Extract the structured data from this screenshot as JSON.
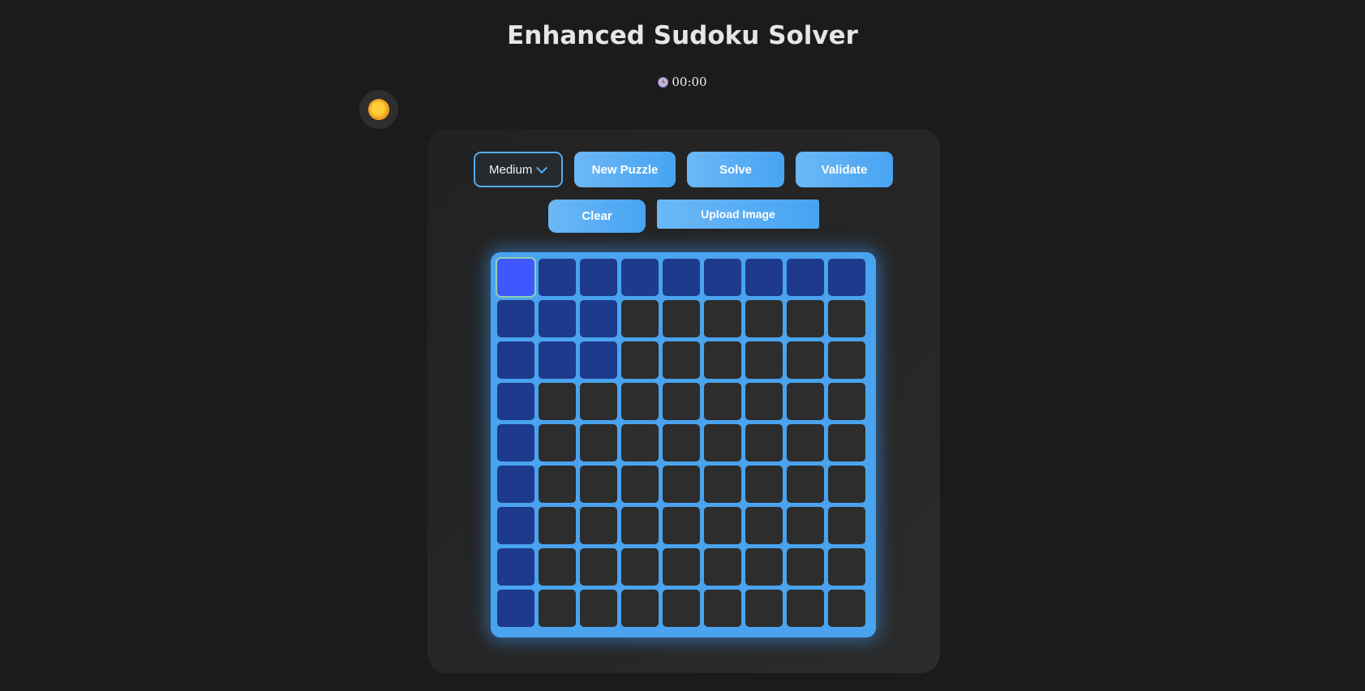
{
  "header": {
    "title": "Enhanced Sudoku Solver",
    "timer": "00:00",
    "timer_icon": "alarm-clock-icon"
  },
  "theme_toggle": {
    "icon": "sun-icon"
  },
  "controls": {
    "difficulty": {
      "selected": "Medium",
      "icon": "chevron-down-icon"
    },
    "new_puzzle_label": "New Puzzle",
    "solve_label": "Solve",
    "validate_label": "Validate",
    "clear_label": "Clear",
    "upload_label": "Upload Image"
  },
  "board": {
    "size": 9,
    "selected": [
      0,
      0
    ],
    "colors": {
      "border": "#4aa3ee",
      "empty": "#2d2d2d",
      "related": "#1d3a8c",
      "selected": "#3f57ff"
    },
    "cells": [
      [
        "",
        "",
        "",
        "",
        "",
        "",
        "",
        "",
        ""
      ],
      [
        "",
        "",
        "",
        "",
        "",
        "",
        "",
        "",
        ""
      ],
      [
        "",
        "",
        "",
        "",
        "",
        "",
        "",
        "",
        ""
      ],
      [
        "",
        "",
        "",
        "",
        "",
        "",
        "",
        "",
        ""
      ],
      [
        "",
        "",
        "",
        "",
        "",
        "",
        "",
        "",
        ""
      ],
      [
        "",
        "",
        "",
        "",
        "",
        "",
        "",
        "",
        ""
      ],
      [
        "",
        "",
        "",
        "",
        "",
        "",
        "",
        "",
        ""
      ],
      [
        "",
        "",
        "",
        "",
        "",
        "",
        "",
        "",
        ""
      ],
      [
        "",
        "",
        "",
        "",
        "",
        "",
        "",
        "",
        ""
      ]
    ]
  }
}
